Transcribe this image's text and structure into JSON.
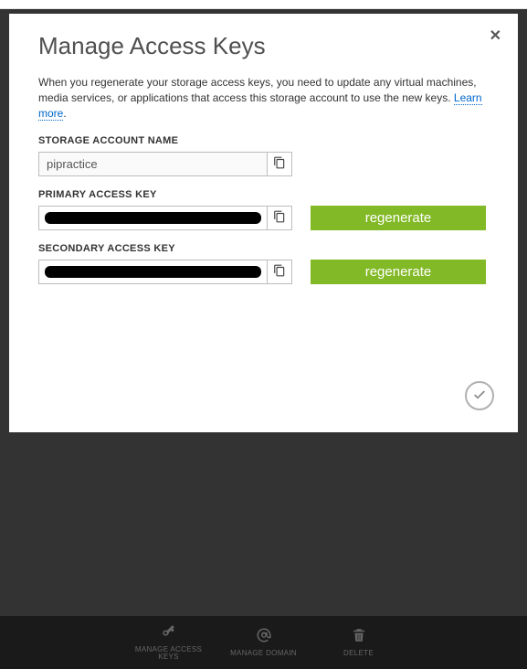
{
  "modal": {
    "title": "Manage Access Keys",
    "description_prefix": "When you regenerate your storage access keys, you need to update any virtual machines, media services, or applications that access this storage account to use the new keys. ",
    "learn_more": "Learn more",
    "account_name_label": "STORAGE ACCOUNT NAME",
    "account_name_value": "pipractice",
    "primary_label": "PRIMARY ACCESS KEY",
    "secondary_label": "SECONDARY ACCESS KEY",
    "regenerate_label": "regenerate"
  },
  "cmdbar": {
    "items": [
      {
        "label": "MANAGE ACCESS KEYS",
        "icon": "key"
      },
      {
        "label": "MANAGE DOMAIN",
        "icon": "at"
      },
      {
        "label": "DELETE",
        "icon": "trash"
      }
    ]
  }
}
